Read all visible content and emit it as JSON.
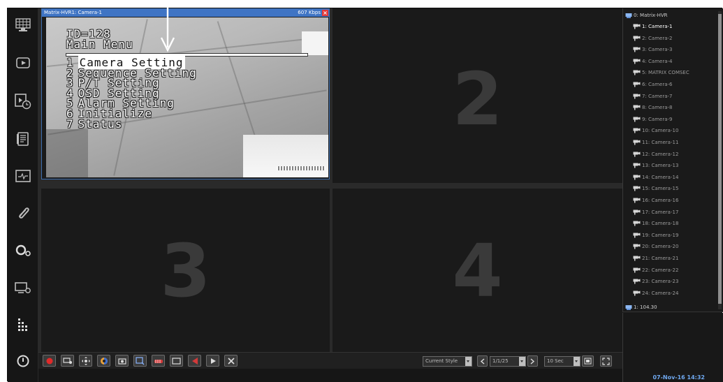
{
  "left_toolbar": {
    "items": [
      {
        "icon": "live-view-grid-icon"
      },
      {
        "icon": "playback-icon"
      },
      {
        "icon": "timed-playback-icon"
      },
      {
        "icon": "event-log-icon"
      },
      {
        "icon": "system-monitor-icon"
      },
      {
        "icon": "attachment-icon"
      },
      {
        "icon": "settings-icon"
      },
      {
        "icon": "device-setup-icon"
      },
      {
        "icon": "matrix-grid-icon"
      },
      {
        "icon": "power-icon"
      }
    ]
  },
  "panes": {
    "pane1": {
      "title": "Matrix-HVR1: Camera-1",
      "bitrate": "607 Kbps",
      "osd": {
        "id_line": "ID=128",
        "menu_title": "Main Menu",
        "items": [
          {
            "num": "1",
            "label": "Camera Setting"
          },
          {
            "num": "2",
            "label": "Sequence Setting"
          },
          {
            "num": "3",
            "label": "P/T Setting"
          },
          {
            "num": "4",
            "label": "OSD Setting"
          },
          {
            "num": "5",
            "label": "Alarm Setting"
          },
          {
            "num": "6",
            "label": "Initialize"
          },
          {
            "num": "7",
            "label": "Status"
          }
        ],
        "selected_index": 0
      }
    },
    "pane2": {
      "number": "2"
    },
    "pane3": {
      "number": "3"
    },
    "pane4": {
      "number": "4"
    }
  },
  "control_bar": {
    "buttons": [
      {
        "icon": "record-icon"
      },
      {
        "icon": "camera-ptz-icon"
      },
      {
        "icon": "ptz-control-icon"
      },
      {
        "icon": "color-adjust-icon"
      },
      {
        "icon": "snapshot-icon"
      },
      {
        "icon": "instant-playback-icon"
      },
      {
        "icon": "audio-icon"
      },
      {
        "icon": "full-view-icon"
      },
      {
        "icon": "alarm-icon"
      },
      {
        "icon": "play-icon"
      },
      {
        "icon": "close-all-icon"
      }
    ],
    "style_select": "Current Style",
    "page_select": "1/1/25",
    "interval_select": "10 Sec"
  },
  "device_tree": {
    "root": "0: Matrix-HVR",
    "cameras": [
      "1: Camera-1",
      "2: Camera-2",
      "3: Camera-3",
      "4: Camera-4",
      "5: MATRIX COMSEC",
      "6: Camera-6",
      "7: Camera-7",
      "8: Camera-8",
      "9: Camera-9",
      "10: Camera-10",
      "11: Camera-11",
      "12: Camera-12",
      "13: Camera-13",
      "14: Camera-14",
      "15: Camera-15",
      "16: Camera-16",
      "17: Camera-17",
      "18: Camera-18",
      "19: Camera-19",
      "20: Camera-20",
      "21: Camera-21",
      "22: Camera-22",
      "23: Camera-23",
      "24: Camera-24"
    ],
    "active_camera_index": 0,
    "second_root": "1: 104.30"
  },
  "status": {
    "datetime": "07-Nov-16 14:32"
  },
  "colors": {
    "accent_blue": "#3f74c4",
    "datetime_blue": "#6fa8ef",
    "record_red": "#e02a2a"
  }
}
